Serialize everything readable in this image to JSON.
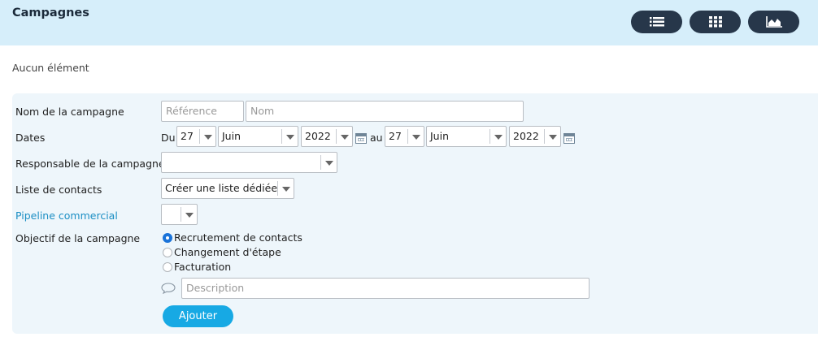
{
  "header": {
    "title": "Campagnes",
    "view_buttons": [
      {
        "icon": "list-icon"
      },
      {
        "icon": "grid-icon"
      },
      {
        "icon": "chart-icon"
      }
    ]
  },
  "empty_message": "Aucun élément",
  "form": {
    "name": {
      "label": "Nom de la campagne",
      "reference_placeholder": "Référence",
      "name_placeholder": "Nom"
    },
    "dates": {
      "label": "Dates",
      "from_label": "Du",
      "to_label": "au",
      "from": {
        "day": "27",
        "month": "Juin",
        "year": "2022"
      },
      "to": {
        "day": "27",
        "month": "Juin",
        "year": "2022"
      }
    },
    "owner": {
      "label": "Responsable de la campagne",
      "value": ""
    },
    "contacts": {
      "label": "Liste de contacts",
      "value": "Créer une liste dédiée"
    },
    "pipeline": {
      "label": "Pipeline commercial",
      "value": ""
    },
    "objective": {
      "label": "Objectif de la campagne",
      "options": [
        "Recrutement de contacts",
        "Changement d'étape",
        "Facturation"
      ],
      "selected": "Recrutement de contacts"
    },
    "description_placeholder": "Description",
    "submit_label": "Ajouter"
  },
  "colors": {
    "header_bg": "#d6eefa",
    "panel_bg": "#eef6fb",
    "dark_button": "#27374a",
    "accent": "#17a9e4",
    "link": "#1c8fc4",
    "radio_selected": "#1a73d9"
  }
}
